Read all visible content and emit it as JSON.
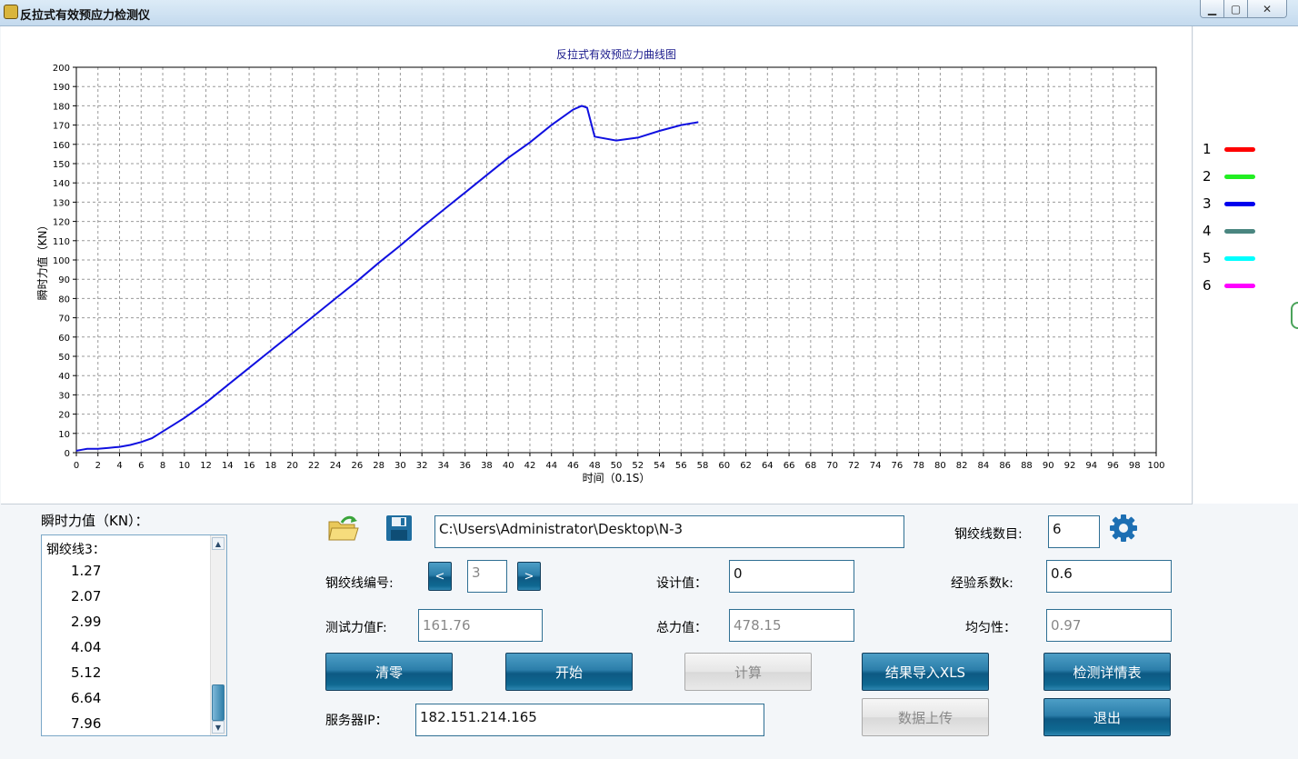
{
  "window": {
    "title": "反拉式有效预应力检测仪",
    "buttons": {
      "minimize": "▁",
      "maximize": "▢",
      "close": "✕"
    }
  },
  "chart_data": {
    "type": "line",
    "title": "反拉式有效预应力曲线图",
    "xlabel": "时间（0.1S）",
    "ylabel": "瞬时力值（KN）",
    "xlim": [
      0,
      100
    ],
    "ylim": [
      0,
      200
    ],
    "x_step": 2,
    "y_step": 10,
    "grid": true,
    "legend_position": "right",
    "series": [
      {
        "name": "3",
        "color": "#1010e0",
        "points": [
          [
            0,
            1
          ],
          [
            0.5,
            1.5
          ],
          [
            1,
            2
          ],
          [
            2,
            2
          ],
          [
            3,
            2.5
          ],
          [
            4,
            3
          ],
          [
            5,
            4
          ],
          [
            6,
            5.5
          ],
          [
            7,
            7.5
          ],
          [
            8,
            11
          ],
          [
            9,
            14.5
          ],
          [
            10,
            18
          ],
          [
            11,
            22
          ],
          [
            12,
            26
          ],
          [
            14,
            35
          ],
          [
            16,
            44
          ],
          [
            18,
            53
          ],
          [
            20,
            62
          ],
          [
            22,
            71
          ],
          [
            24,
            80
          ],
          [
            26,
            89
          ],
          [
            28,
            98.5
          ],
          [
            30,
            107.5
          ],
          [
            32,
            117
          ],
          [
            34,
            126
          ],
          [
            36,
            135
          ],
          [
            38,
            144
          ],
          [
            40,
            153
          ],
          [
            42,
            161
          ],
          [
            44,
            170
          ],
          [
            46,
            178
          ],
          [
            46.8,
            180
          ],
          [
            47.3,
            179
          ],
          [
            48,
            164
          ],
          [
            50,
            162
          ],
          [
            52,
            163.5
          ],
          [
            54,
            167
          ],
          [
            56,
            170
          ],
          [
            57.6,
            171.5
          ]
        ]
      }
    ],
    "series_legend": [
      {
        "label": "1",
        "color": "#ff0000"
      },
      {
        "label": "2",
        "color": "#22ee22"
      },
      {
        "label": "3",
        "color": "#0000ee"
      },
      {
        "label": "4",
        "color": "#4a8680"
      },
      {
        "label": "5",
        "color": "#00ffff"
      },
      {
        "label": "6",
        "color": "#ff00ff"
      }
    ]
  },
  "readings": {
    "title": "瞬时力值（KN）：",
    "group": "钢绞线3：",
    "values": [
      "1.27",
      "2.07",
      "2.99",
      "4.04",
      "5.12",
      "6.64",
      "7.96"
    ]
  },
  "form": {
    "path": "C:\\Users\\Administrator\\Desktop\\N-3",
    "strand_count_label": "钢绞线数目:",
    "strand_count": "6",
    "strand_no_label": "钢绞线编号:",
    "prev": "<",
    "strand_no": "3",
    "next": ">",
    "design_label": "设计值：",
    "design_value": "0",
    "k_label": "经验系数k:",
    "k_value": "0.6",
    "force_label": "测试力值F:",
    "force_value": "161.76",
    "total_label": "总力值：",
    "total_value": "478.15",
    "uniform_label": "均匀性：",
    "uniform_value": "0.97",
    "server_label": "服务器IP：",
    "server_ip": "182.151.214.165"
  },
  "buttons": {
    "zero": "清零",
    "start": "开始",
    "calc": "计算",
    "export": "结果导入XLS",
    "details": "检测详情表",
    "upload": "数据上传",
    "exit": "退出"
  }
}
